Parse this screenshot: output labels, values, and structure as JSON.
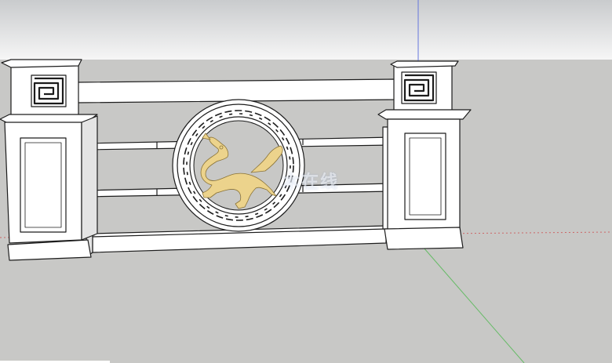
{
  "canvas": {
    "sky_top": "#c9cbcd",
    "sky_bottom": "#f6f6f6",
    "ground": "#c8c8c6"
  },
  "axes": {
    "red": "#cc6666",
    "green": "#66bb66",
    "blue": "#6677dd"
  },
  "model": {
    "stone": "#ffffff",
    "line": "#1c1c1c",
    "shadow": "#e4e4e4",
    "emblem_color": "#ecd38c",
    "emblem_shape": "qilin-dragon-icon"
  },
  "watermark": {
    "text": "木在线"
  }
}
